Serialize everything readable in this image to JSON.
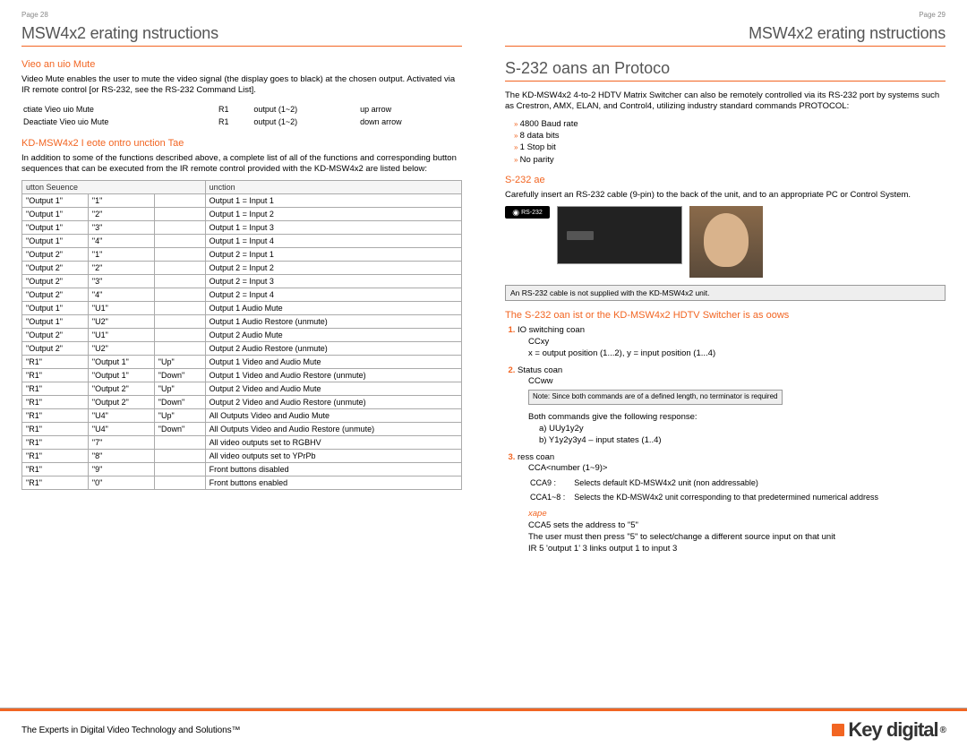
{
  "left": {
    "pagenum": "Page 28",
    "title": "MSW4x2 erating nstructions",
    "mute_heading": "Vieo an uio Mute",
    "mute_text": "Video Mute enables the user to mute the video signal (the display goes to black) at the chosen output. Activated via IR remote control [or RS-232, see the RS-232 Command List].",
    "mute_rows": [
      [
        "ctiate Vieo  uio Mute",
        "R1",
        "output (1~2)",
        "up arrow"
      ],
      [
        "Deactiate Vieo  uio Mute",
        "R1",
        "output (1~2)",
        "down arrow"
      ]
    ],
    "func_heading": "KD-MSW4x2 I eote ontro unction Tae",
    "func_text": "In addition to some of the functions described above, a complete list of all of the functions and corresponding button sequences that can be executed from the IR remote control provided with the KD-MSW4x2 are listed below:",
    "func_headers": {
      "seq": "utton Seuence",
      "fn": "unction"
    },
    "func_rows": [
      [
        "\"Output 1\"",
        "\"1\"",
        "",
        "Output 1 = Input 1"
      ],
      [
        "\"Output 1\"",
        "\"2\"",
        "",
        "Output 1 = Input 2"
      ],
      [
        "\"Output 1\"",
        "\"3\"",
        "",
        "Output 1 = Input 3"
      ],
      [
        "\"Output 1\"",
        "\"4\"",
        "",
        "Output 1 = Input 4"
      ],
      [
        "\"Output 2\"",
        "\"1\"",
        "",
        "Output 2 = Input 1"
      ],
      [
        "\"Output 2\"",
        "\"2\"",
        "",
        "Output 2 = Input 2"
      ],
      [
        "\"Output 2\"",
        "\"3\"",
        "",
        "Output 2 = Input 3"
      ],
      [
        "\"Output 2\"",
        "\"4\"",
        "",
        "Output 2 = Input 4"
      ],
      [
        "\"Output 1\"",
        "\"U1\"",
        "",
        "Output 1 Audio Mute"
      ],
      [
        "\"Output 1\"",
        "\"U2\"",
        "",
        "Output 1 Audio Restore (unmute)"
      ],
      [
        "\"Output 2\"",
        "\"U1\"",
        "",
        "Output 2 Audio Mute"
      ],
      [
        "\"Output 2\"",
        "\"U2\"",
        "",
        "Output 2 Audio Restore (unmute)"
      ],
      [
        "\"R1\"",
        "\"Output 1\"",
        "\"Up\"",
        "Output 1 Video and Audio Mute"
      ],
      [
        "\"R1\"",
        "\"Output 1\"",
        "\"Down\"",
        "Output 1 Video and Audio Restore (unmute)"
      ],
      [
        "\"R1\"",
        "\"Output 2\"",
        "\"Up\"",
        "Output 2 Video and Audio Mute"
      ],
      [
        "\"R1\"",
        "\"Output 2\"",
        "\"Down\"",
        "Output 2 Video and Audio Restore (unmute)"
      ],
      [
        "\"R1\"",
        "\"U4\"",
        "\"Up\"",
        "All Outputs Video and Audio Mute"
      ],
      [
        "\"R1\"",
        "\"U4\"",
        "\"Down\"",
        "All Outputs Video and Audio Restore (unmute)"
      ],
      [
        "\"R1\"",
        "\"7\"",
        "",
        "All video outputs set to RGBHV"
      ],
      [
        "\"R1\"",
        "\"8\"",
        "",
        "All video outputs set to YPrPb"
      ],
      [
        "\"R1\"",
        "\"9\"",
        "",
        "Front buttons disabled"
      ],
      [
        "\"R1\"",
        "\"0\"",
        "",
        "Front buttons enabled"
      ]
    ]
  },
  "right": {
    "pagenum": "Page 29",
    "title": "MSW4x2 erating nstructions",
    "big_section": "S-232 oans an Protoco",
    "intro": "The KD-MSW4x2 4-to-2 HDTV Matrix Switcher can also be remotely controlled via its RS-232 port by systems such as Crestron, AMX, ELAN, and Control4, utilizing industry standard commands PROTOCOL:",
    "protocol": [
      "4800 Baud rate",
      "8 data bits",
      "1 Stop bit",
      "No parity"
    ],
    "cable_heading": "S-232 ae",
    "cable_text": "Carefully insert an RS-232 cable (9-pin) to the back of the unit, and to an appropriate PC or Control System.",
    "rs232_label": "RS-232",
    "cable_note": "An RS-232 cable is not supplied with the KD-MSW4x2 unit.",
    "list_heading": "The S-232 oan ist or the KD-MSW4x2 HDTV Switcher is as oows",
    "cmd1_title": "IO switching coan",
    "cmd1_code": "CCxy",
    "cmd1_desc": "x = output position (1...2), y = input position (1...4)",
    "cmd2_title": "Status coan",
    "cmd2_code": "CCww",
    "cmd2_note": "Note:  Since both commands are of a defined length, no terminator is required",
    "both_resp": "Both commands give the following response:",
    "resp_a": "a) UUy1y2y",
    "resp_b": "b) Y1y2y3y4 – input states (1..4)",
    "cmd3_title": "ress coan",
    "cmd3_code": "CCA<number (1~9)>",
    "defs": [
      [
        "CCA9 :",
        "Selects default KD-MSW4x2 unit (non addressable)"
      ],
      [
        "CCA1~8 :",
        "Selects the KD-MSW4x2 unit corresponding to that predetermined numerical address"
      ]
    ],
    "example_label": "xape",
    "example1": "CCA5 sets the address to \"5\"",
    "example2": "The user must then press \"5\" to select/change a different source input on that unit",
    "example3": "IR 5    'output 1'    3 links output 1 to input 3"
  },
  "footer": {
    "tagline": "The Experts in Digital Video Technology and Solutions™",
    "logo_text": "Key digital"
  }
}
